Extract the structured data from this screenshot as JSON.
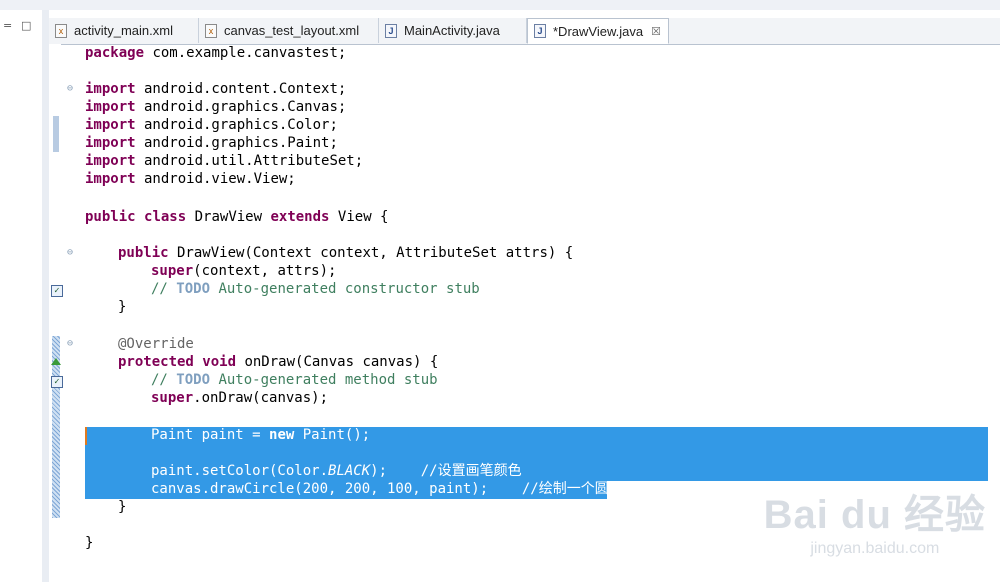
{
  "left_pane": {
    "minimize_icon": "minimize-icon",
    "maximize_icon": "maximize-icon",
    "minimize_glyph": "=",
    "maximize_glyph": "□"
  },
  "tabs": [
    {
      "label": "activity_main.xml",
      "icon": "xml-file-icon",
      "active": false
    },
    {
      "label": "canvas_test_layout.xml",
      "icon": "xml-file-icon",
      "active": false
    },
    {
      "label": "MainActivity.java",
      "icon": "java-file-icon",
      "active": false
    },
    {
      "label": "*DrawView.java",
      "icon": "java-file-icon",
      "active": true,
      "close_glyph": "☒"
    }
  ],
  "code": {
    "l1_kw": "package",
    "l1_rest": " com.example.canvastest;",
    "imp_kw": "import",
    "imports": [
      " android.content.Context;",
      " android.graphics.Canvas;",
      " android.graphics.Color;",
      " android.graphics.Paint;",
      " android.util.AttributeSet;",
      " android.view.View;"
    ],
    "cls_kw1": "public",
    "cls_kw2": "class",
    "cls_name": " DrawView ",
    "cls_kw3": "extends",
    "cls_rest": " View {",
    "ctor_kw": "public",
    "ctor_rest": " DrawView(Context context, AttributeSet attrs) {",
    "super_kw": "super",
    "super_rest": "(context, attrs);",
    "todo_prefix": "// ",
    "todo_word": "TODO",
    "ctor_comment": " Auto-generated constructor stub",
    "close_brace": "}",
    "override": "@Override",
    "m_kw1": "protected",
    "m_kw2": "void",
    "m_rest": " onDraw(Canvas canvas) {",
    "m_comment": " Auto-generated method stub",
    "m_super_kw": "super",
    "m_super_rest": ".onDraw(canvas);",
    "paint_a": "Paint paint = ",
    "paint_kw": "new",
    "paint_b": " Paint();",
    "setcolor_a": "paint.setColor(Color.",
    "setcolor_it": "BLACK",
    "setcolor_b": ");    //设置画笔颜色",
    "circle": "canvas.drawCircle(200, 200, 100, paint);    //绘制一个圆",
    "end_brace": "}"
  },
  "watermark": {
    "line1": "Bai du 经验",
    "line2": "jingyan.baidu.com"
  }
}
